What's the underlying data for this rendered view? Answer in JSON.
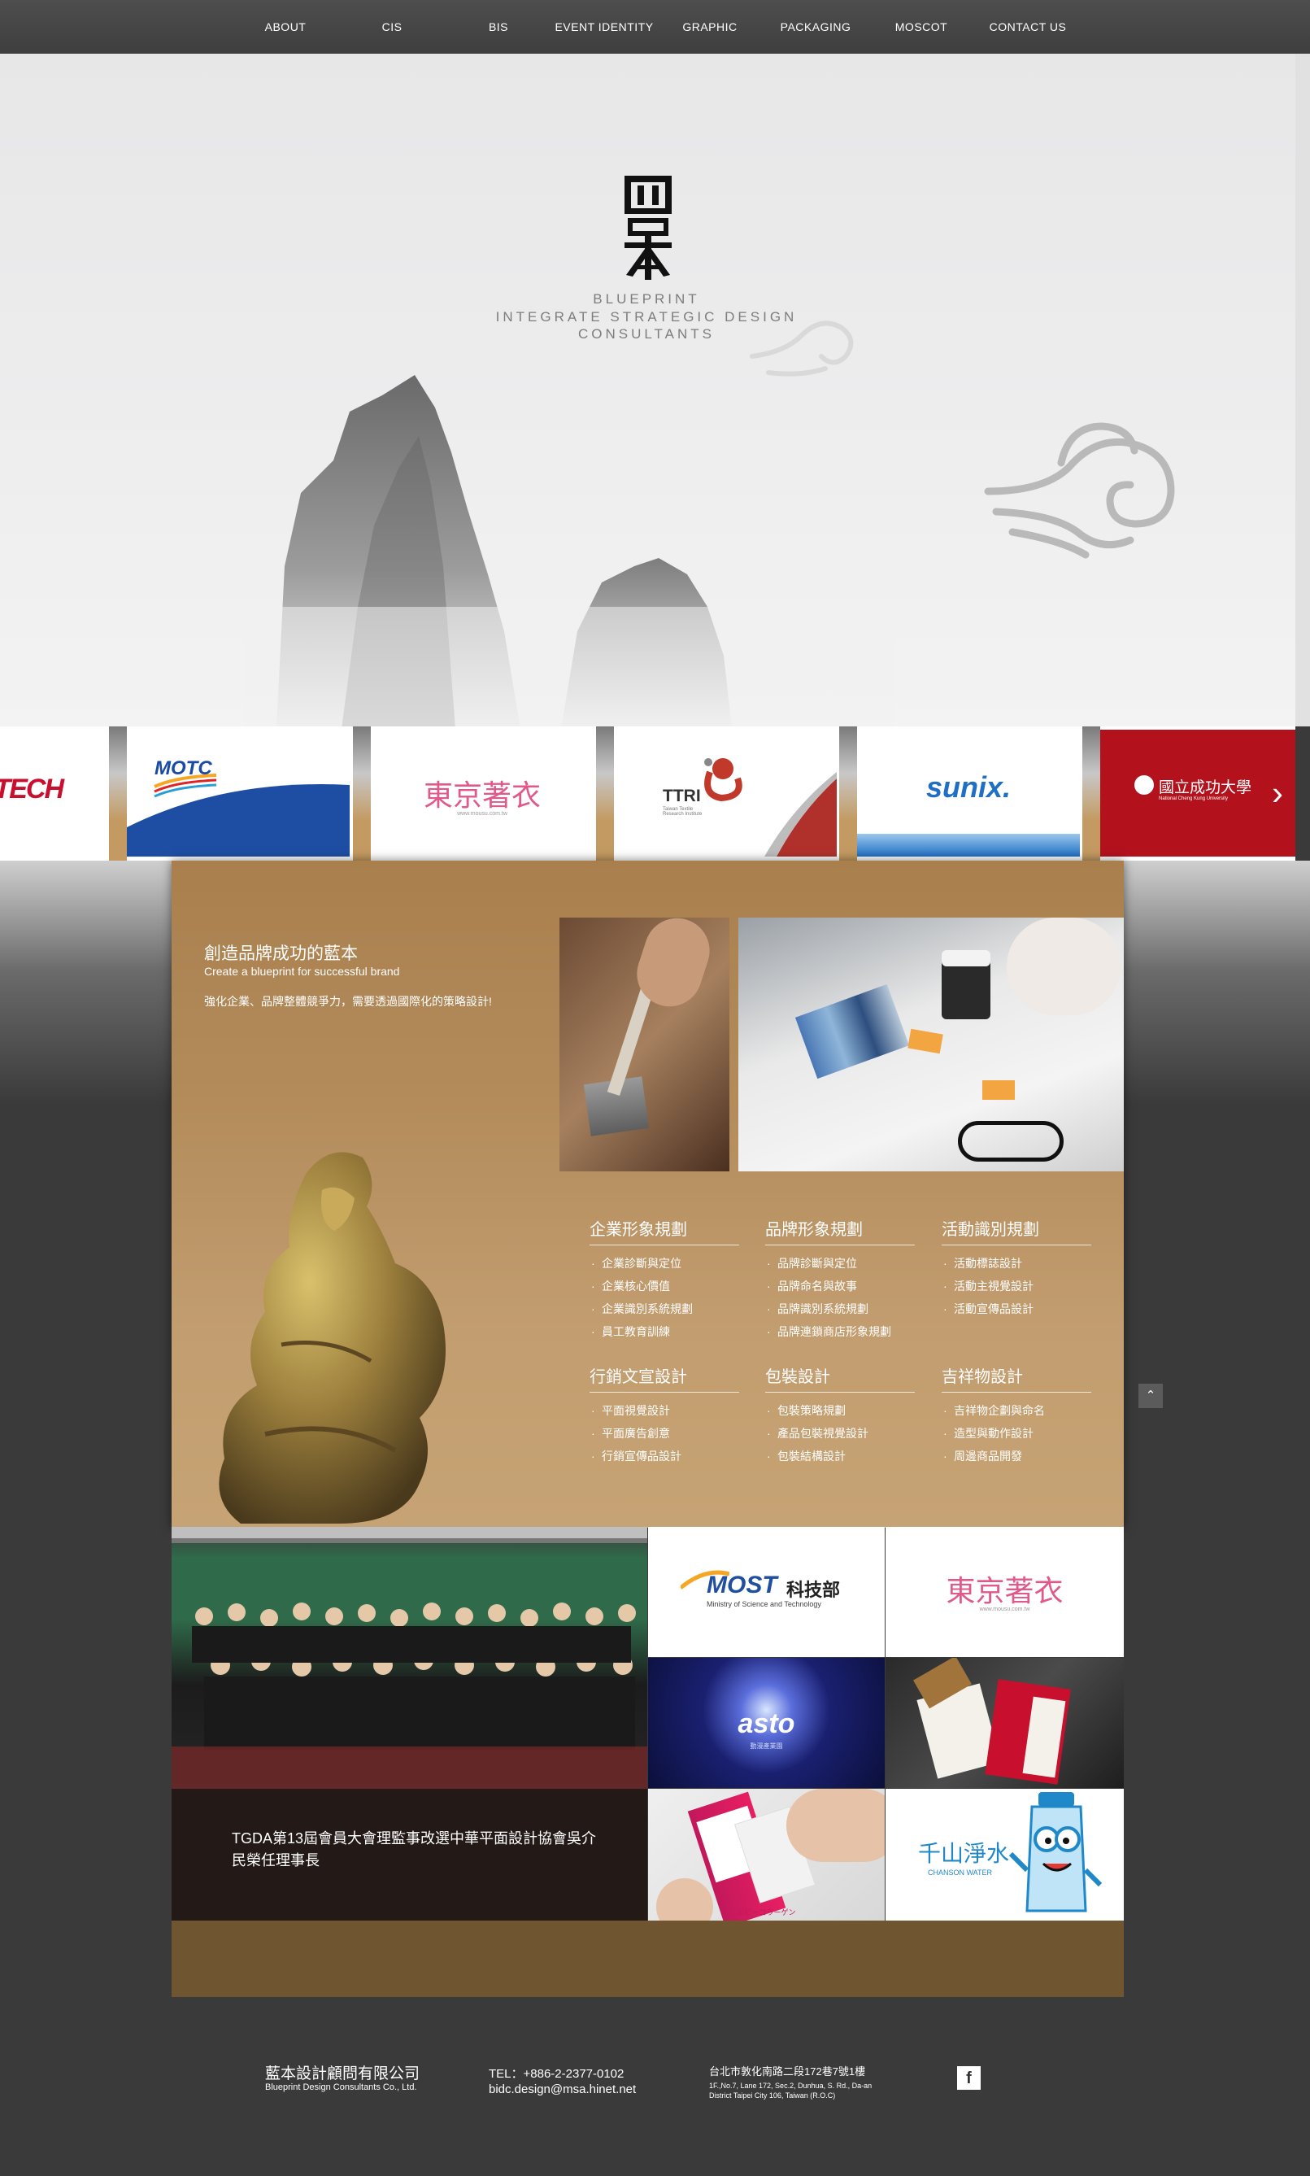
{
  "nav": {
    "items": [
      "ABOUT",
      "CIS",
      "BIS",
      "EVENT IDENTITY",
      "GRAPHIC",
      "PACKAGING",
      "MOSCOT",
      "CONTACT US"
    ]
  },
  "hero": {
    "tagline": [
      "BLUEPRINT",
      "INTEGRATE STRATEGIC DESIGN",
      "CONSULTANTS"
    ]
  },
  "carousel": {
    "slides": [
      {
        "text": "TECH",
        "color": "#c8102e"
      },
      {
        "text": "MOTC",
        "color": "#1a4aa3"
      },
      {
        "text": "東京著衣",
        "sub": "www.mousu.com.tw",
        "color": "#e0598b"
      },
      {
        "text": "TTRI",
        "sub": "Taiwan Textile Research Institute",
        "color": "#444444"
      },
      {
        "text": "sunix.",
        "color": "#1f6fc4"
      },
      {
        "text": "國立成功大學",
        "sub": "National Cheng Kung University",
        "color": "#b3121d"
      }
    ],
    "next_arrow": "›"
  },
  "intro": {
    "title": "創造品牌成功的藍本",
    "subtitle": "Create a blueprint for successful brand",
    "description": "強化企業、品牌整體競爭力，需要透過國際化的策略設計!"
  },
  "services": [
    {
      "title": "企業形象規劃",
      "items": [
        "企業診斷與定位",
        "企業核心價值",
        "企業識別系統規劃",
        "員工教育訓練"
      ]
    },
    {
      "title": "品牌形象規劃",
      "items": [
        "品牌診斷與定位",
        "品牌命名與故事",
        "品牌識別系統規劃",
        "品牌連鎖商店形象規劃"
      ]
    },
    {
      "title": "活動識別規劃",
      "items": [
        "活動標誌設計",
        "活動主視覺設計",
        "活動宣傳品設計"
      ]
    },
    {
      "title": "行銷文宣設計",
      "items": [
        "平面視覺設計",
        "平面廣告創意",
        "行銷宣傳品設計"
      ]
    },
    {
      "title": "包裝設計",
      "items": [
        "包裝策略規劃",
        "產品包裝視覺設計",
        "包裝結構設計"
      ]
    },
    {
      "title": "吉祥物設計",
      "items": [
        "吉祥物企劃與命名",
        "造型與動作設計",
        "周邊商品開發"
      ]
    }
  ],
  "portfolio": {
    "most": {
      "name": "MOST",
      "zh": "科技部",
      "en": "Ministry of Science and Technology"
    },
    "tokyo": {
      "name": "東京著衣",
      "sub": "www.mousu.com.tw"
    },
    "asto": {
      "name": "asto",
      "sub": "動漫產業園"
    },
    "water": {
      "name": "千山淨水",
      "sub": "CHANSON WATER"
    },
    "package_label": "ルビーコラーゲン"
  },
  "news": {
    "text": "TGDA第13屆會員大會理監事改選中華平面設計協會吳介民榮任理事長"
  },
  "totop": "⌃",
  "footer": {
    "company": "藍本設計顧問有限公司",
    "company_en": "Blueprint Design Consultants Co., Ltd.",
    "tel": "TEL：+886-2-2377-0102",
    "email": "bidc.design@msa.hinet.net",
    "address": "台北市敦化南路二段172巷7號1樓",
    "address_en": "1F.,No.7, Lane 172, Sec.2, Dunhua, S. Rd., Da-an District Taipei City 106, Taiwan (R.O.C)",
    "facebook": "f"
  }
}
